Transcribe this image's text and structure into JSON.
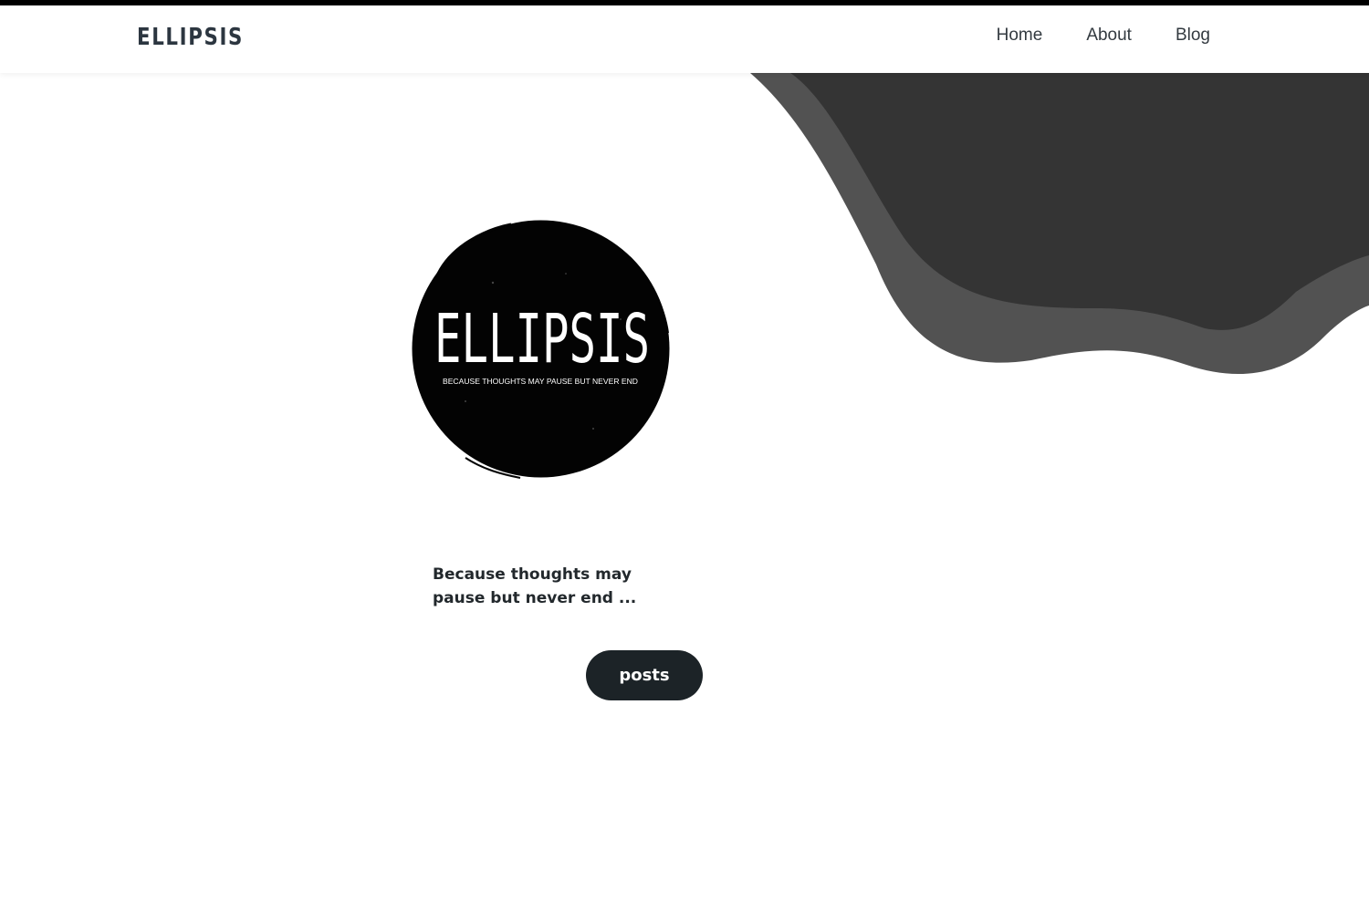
{
  "header": {
    "brand": "ELLIPSIS",
    "nav": [
      "Home",
      "About",
      "Blog"
    ]
  },
  "hero": {
    "logo": {
      "title": "ELLIPSIS",
      "subtitle": "BECAUSE THOUGHTS MAY PAUSE BUT NEVER END"
    },
    "tagline": "Because thoughts may pause but never end ...",
    "button_label": "posts"
  },
  "colors": {
    "accent_bar": "#000000",
    "blob_dark": "#343434",
    "blob_mid": "#525252",
    "button_bg": "#1c2327",
    "text": "#22282c"
  }
}
